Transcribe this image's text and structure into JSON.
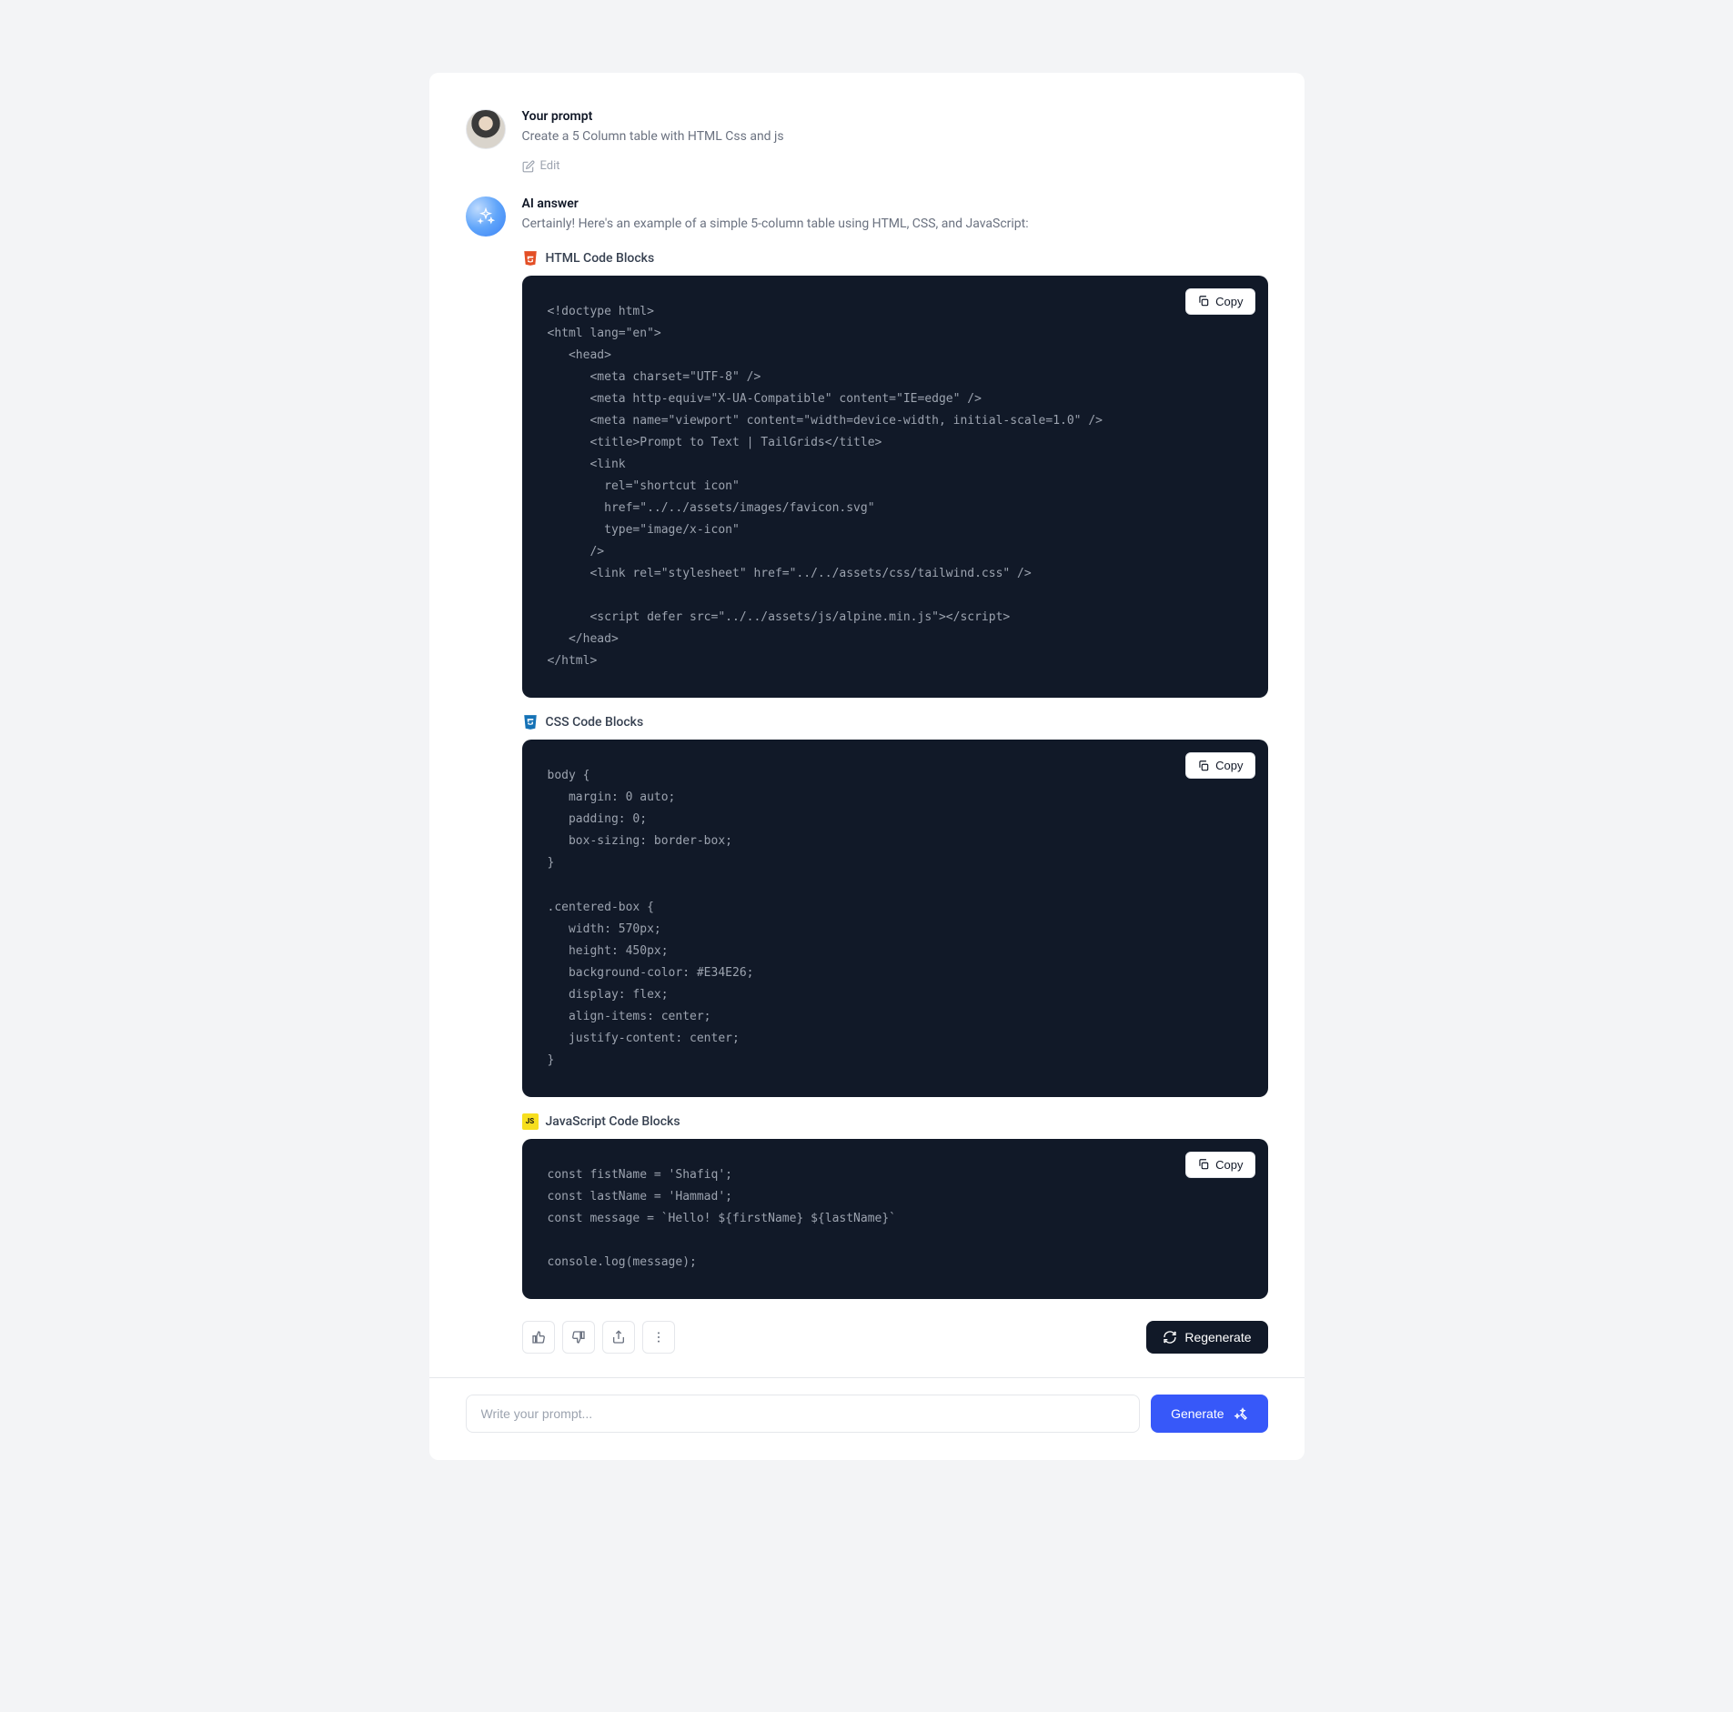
{
  "user": {
    "label": "Your prompt",
    "text": "Create a 5 Column table with HTML Css and js",
    "edit_label": "Edit"
  },
  "ai": {
    "label": "AI answer",
    "intro": "Certainly! Here's an example of a simple 5-column table using HTML, CSS, and JavaScript:"
  },
  "blocks": {
    "html": {
      "title": "HTML Code Blocks",
      "copy_label": "Copy",
      "code": "<!doctype html>\n<html lang=\"en\">\n   <head>\n      <meta charset=\"UTF-8\" />\n      <meta http-equiv=\"X-UA-Compatible\" content=\"IE=edge\" />\n      <meta name=\"viewport\" content=\"width=device-width, initial-scale=1.0\" />\n      <title>Prompt to Text | TailGrids</title>\n      <link\n        rel=\"shortcut icon\"\n        href=\"../../assets/images/favicon.svg\"\n        type=\"image/x-icon\"\n      />\n      <link rel=\"stylesheet\" href=\"../../assets/css/tailwind.css\" />\n\n      <script defer src=\"../../assets/js/alpine.min.js\"></script>\n   </head>\n</html>"
    },
    "css": {
      "title": "CSS Code Blocks",
      "copy_label": "Copy",
      "code": "body {\n   margin: 0 auto;\n   padding: 0;\n   box-sizing: border-box;\n}\n\n.centered-box {\n   width: 570px;\n   height: 450px;\n   background-color: #E34E26;\n   display: flex;\n   align-items: center;\n   justify-content: center;\n}"
    },
    "js": {
      "title": "JavaScript Code Blocks",
      "copy_label": "Copy",
      "code": "const fistName = 'Shafiq';\nconst lastName = 'Hammad';\nconst message = `Hello! ${firstName} ${lastName}`\n\nconsole.log(message);"
    }
  },
  "actions": {
    "regenerate_label": "Regenerate"
  },
  "composer": {
    "placeholder": "Write your prompt...",
    "generate_label": "Generate"
  },
  "lang_badges": {
    "js": "JS"
  }
}
